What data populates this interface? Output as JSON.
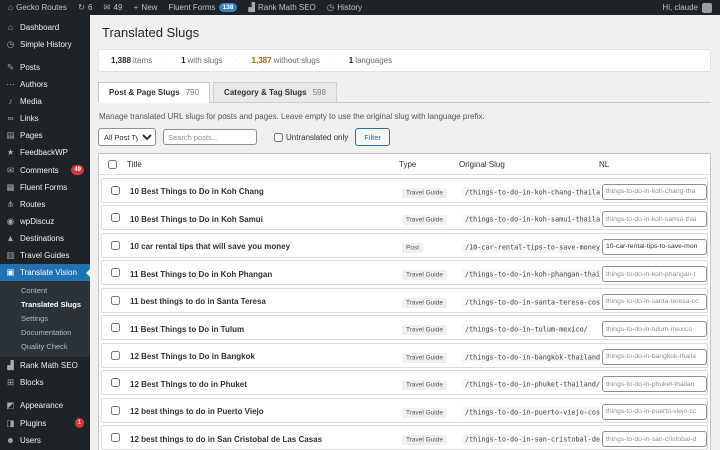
{
  "admin_bar": {
    "site": {
      "icon": "⌂",
      "name": "Gecko Routes"
    },
    "updates": {
      "icon": "↻",
      "count": "6"
    },
    "comments": {
      "icon": "✉",
      "count": "49"
    },
    "new_item": {
      "icon": "+",
      "label": "New"
    },
    "fluent_forms": {
      "label": "Fluent Forms",
      "badge": "138"
    },
    "rank_math": {
      "icon": "▟",
      "label": "Rank Math SEO"
    },
    "history": {
      "icon": "◷",
      "label": "History"
    },
    "greeting": "Hi, claude"
  },
  "sidebar": {
    "items": [
      {
        "id": "dashboard",
        "icon": "⌂",
        "label": "Dashboard"
      },
      {
        "id": "simple-history",
        "icon": "◷",
        "label": "Simple History"
      },
      {
        "id": "sep-1",
        "separator": true
      },
      {
        "id": "posts",
        "icon": "✎",
        "label": "Posts"
      },
      {
        "id": "authors",
        "icon": "⋯",
        "label": "Authors"
      },
      {
        "id": "media",
        "icon": "♪",
        "label": "Media"
      },
      {
        "id": "links",
        "icon": "∞",
        "label": "Links"
      },
      {
        "id": "pages",
        "icon": "▤",
        "label": "Pages"
      },
      {
        "id": "feedbackwp",
        "icon": "★",
        "label": "FeedbackWP"
      },
      {
        "id": "comments",
        "icon": "✉",
        "label": "Comments",
        "badge": "49"
      },
      {
        "id": "fluent-forms",
        "icon": "▦",
        "label": "Fluent Forms"
      },
      {
        "id": "routes",
        "icon": "⋔",
        "label": "Routes"
      },
      {
        "id": "wpdiscuz",
        "icon": "◉",
        "label": "wpDiscuz"
      },
      {
        "id": "destinations",
        "icon": "▲",
        "label": "Destinations"
      },
      {
        "id": "travel-guides",
        "icon": "▥",
        "label": "Travel Guides"
      },
      {
        "id": "translate-vision",
        "icon": "▣",
        "label": "Translate Vision",
        "active": true,
        "submenu": [
          {
            "id": "content",
            "label": "Content"
          },
          {
            "id": "translated-slugs",
            "label": "Translated Slugs",
            "current": true
          },
          {
            "id": "settings",
            "label": "Settings"
          },
          {
            "id": "documentation",
            "label": "Documentation"
          },
          {
            "id": "quality-check",
            "label": "Quality Check"
          }
        ]
      },
      {
        "id": "rank-math-seo",
        "icon": "▟",
        "label": "Rank Math SEO"
      },
      {
        "id": "blocks",
        "icon": "⊞",
        "label": "Blocks"
      },
      {
        "id": "sep-2",
        "separator": true
      },
      {
        "id": "appearance",
        "icon": "◩",
        "label": "Appearance"
      },
      {
        "id": "plugins",
        "icon": "◨",
        "label": "Plugins",
        "badge": "1"
      },
      {
        "id": "users",
        "icon": "☻",
        "label": "Users"
      }
    ]
  },
  "page": {
    "title": "Translated Slugs",
    "stats": [
      {
        "value": "1,388",
        "label": "items"
      },
      {
        "value": "1",
        "label": "with slugs"
      },
      {
        "value": "1,387",
        "label": "without slugs"
      },
      {
        "value": "1",
        "label": "languages"
      }
    ],
    "tabs": [
      {
        "label": "Post & Page Slugs",
        "count": "790",
        "active": true
      },
      {
        "label": "Category & Tag Slugs",
        "count": "598",
        "active": false
      }
    ],
    "description": "Manage translated URL slugs for posts and pages. Leave empty to use the original slug with language prefix.",
    "filters": {
      "post_type_selected": "All Post Types",
      "search_placeholder": "Search posts...",
      "untranslated_label": "Untranslated only",
      "filter_button": "Filter"
    },
    "table": {
      "columns": [
        "Title",
        "Type",
        "Original Slug",
        "NL"
      ],
      "rows": [
        {
          "title": "10 Best Things to Do in Koh Chang",
          "type": "Travel Guide",
          "slug": "/things-to-do-in-koh-chang-thailand/",
          "nl_placeholder": "things-to-do-in-koh-chang-tha",
          "nl_value": ""
        },
        {
          "title": "10 Best Things to Do in Koh Samui",
          "type": "Travel Guide",
          "slug": "/things-to-do-in-koh-samui-thailand/",
          "nl_placeholder": "things-to-do-in-koh-samui-thai",
          "nl_value": ""
        },
        {
          "title": "10 car rental tips that will save you money",
          "type": "Post",
          "slug": "/10-car-rental-tips-to-save-money/",
          "nl_placeholder": "",
          "nl_value": "10-car-rental-tips-to-save-mon"
        },
        {
          "title": "11 Best Things to Do in Koh Phangan",
          "type": "Travel Guide",
          "slug": "/things-to-do-in-koh-phangan-thailand/",
          "nl_placeholder": "things-to-do-in-koh-phangan-t",
          "nl_value": ""
        },
        {
          "title": "11 best things to do in Santa Teresa",
          "type": "Travel Guide",
          "slug": "/things-to-do-in-santa-teresa-costa-rica/",
          "nl_placeholder": "things-to-do-in-santa-teresa-cc",
          "nl_value": ""
        },
        {
          "title": "11 Best Things to Do in Tulum",
          "type": "Travel Guide",
          "slug": "/things-to-do-in-tulum-mexico/",
          "nl_placeholder": "things-to-do-in-tulum-mexico",
          "nl_value": ""
        },
        {
          "title": "12 Best Things to Do in Bangkok",
          "type": "Travel Guide",
          "slug": "/things-to-do-in-bangkok-thailand/",
          "nl_placeholder": "things-to-do-in-bangkok-thaila",
          "nl_value": ""
        },
        {
          "title": "12 Best Things to do in Phuket",
          "type": "Travel Guide",
          "slug": "/things-to-do-in-phuket-thailand/",
          "nl_placeholder": "things-to-do-in-phuket-thailan",
          "nl_value": ""
        },
        {
          "title": "12 best things to do in Puerto Viejo",
          "type": "Travel Guide",
          "slug": "/things-to-do-in-puerto-viejo-costa-rica/",
          "nl_placeholder": "things-to-do-in-puerto-viejo-cc",
          "nl_value": ""
        },
        {
          "title": "12 best things to do in San Cristobal de Las Casas",
          "type": "Travel Guide",
          "slug": "/things-to-do-in-san-cristobal-de-las-casas-mexico/",
          "nl_placeholder": "things-to-do-in-san-cristobal-d",
          "nl_value": ""
        }
      ]
    }
  },
  "colors": {
    "accent": "#2271b1",
    "badge_red": "#d63638",
    "warning_orange": "#b26200",
    "admin_dark": "#1d2327"
  }
}
